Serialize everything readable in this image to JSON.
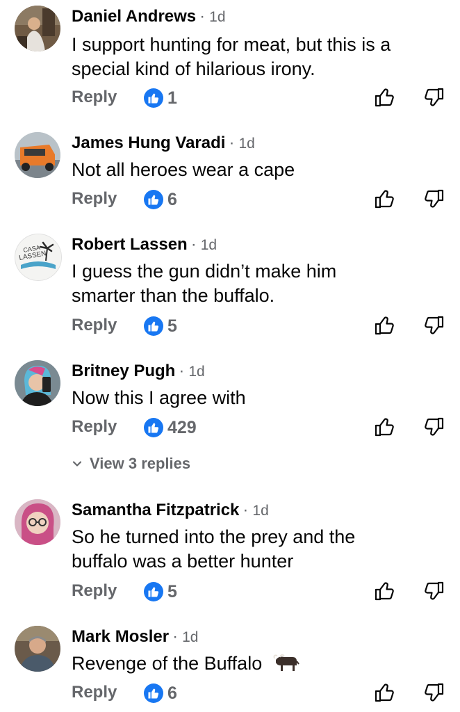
{
  "colors": {
    "accent": "#1877f2",
    "secondary_text": "#65676b",
    "primary_text": "#050505"
  },
  "comments": [
    {
      "author": "Daniel Andrews",
      "time": "1d",
      "text_lines": [
        "I support hunting for meat, but this is a",
        "special kind of hilarious irony."
      ],
      "reply_label": "Reply",
      "likes": "1"
    },
    {
      "author": "James Hung Varadi",
      "time": "1d",
      "text_lines": [
        "Not all heroes wear a cape"
      ],
      "reply_label": "Reply",
      "likes": "6"
    },
    {
      "author": "Robert Lassen",
      "time": "1d",
      "avatar_logo_text": "CASA LASSEN",
      "text_lines": [
        "I guess the gun didn’t make him",
        "smarter than the buffalo."
      ],
      "reply_label": "Reply",
      "likes": "5"
    },
    {
      "author": "Britney Pugh",
      "time": "1d",
      "text_lines": [
        "Now this I agree with"
      ],
      "reply_label": "Reply",
      "likes": "429",
      "view_replies": "View 3 replies"
    },
    {
      "author": "Samantha Fitzpatrick",
      "time": "1d",
      "text_lines": [
        "So he turned into the prey and the",
        "buffalo was a better hunter"
      ],
      "reply_label": "Reply",
      "likes": "5"
    },
    {
      "author": "Mark Mosler",
      "time": "1d",
      "text_lines": [
        "Revenge of the Buffalo"
      ],
      "emoji": "buffalo-emoji",
      "reply_label": "Reply",
      "likes": "6"
    }
  ],
  "separator": "·",
  "icons": {
    "like_badge": "thumbs-up-badge-icon",
    "like": "thumbs-up-outline-icon",
    "dislike": "thumbs-down-outline-icon",
    "expand": "chevron-down-icon"
  }
}
